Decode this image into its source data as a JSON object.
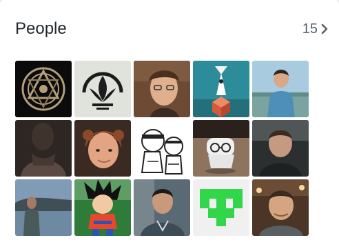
{
  "people_section": {
    "title": "People",
    "count": "15",
    "avatars": [
      {
        "icon": "celtic-knot-avatar",
        "colors": [
          "#0b0b0b",
          "#b3a07a"
        ]
      },
      {
        "icon": "lotus-circle-avatar",
        "colors": [
          "#dfe3dc",
          "#1c1c1c"
        ]
      },
      {
        "icon": "person-photo-avatar",
        "colors": [
          "#6d4a33",
          "#e0b08e"
        ]
      },
      {
        "icon": "monument-valley-avatar",
        "colors": [
          "#2c8c9a",
          "#e96a4b"
        ]
      },
      {
        "icon": "person-photo-avatar",
        "colors": [
          "#a9cbe0",
          "#4e8fb8"
        ]
      },
      {
        "icon": "person-photo-avatar",
        "colors": [
          "#2e2623",
          "#5b4a43"
        ]
      },
      {
        "icon": "person-photo-avatar",
        "colors": [
          "#3a2a22",
          "#e2a482"
        ]
      },
      {
        "icon": "cartoon-sketch-avatar",
        "colors": [
          "#ffffff",
          "#222222"
        ]
      },
      {
        "icon": "white-robot-avatar",
        "colors": [
          "#8e745f",
          "#f1f1f1"
        ]
      },
      {
        "icon": "person-photo-avatar",
        "colors": [
          "#2c2f2f",
          "#c49a80"
        ]
      },
      {
        "icon": "person-photo-avatar",
        "colors": [
          "#7f9bb6",
          "#495a5a"
        ]
      },
      {
        "icon": "goku-cartoon-avatar",
        "colors": [
          "#2f7c3a",
          "#e8472b"
        ]
      },
      {
        "icon": "person-photo-avatar",
        "colors": [
          "#5a6a74",
          "#c89a7a"
        ]
      },
      {
        "icon": "green-identicon-avatar",
        "colors": [
          "#f0f0f0",
          "#32d64b"
        ]
      },
      {
        "icon": "person-photo-avatar",
        "colors": [
          "#4a3526",
          "#d5a582"
        ]
      }
    ]
  }
}
